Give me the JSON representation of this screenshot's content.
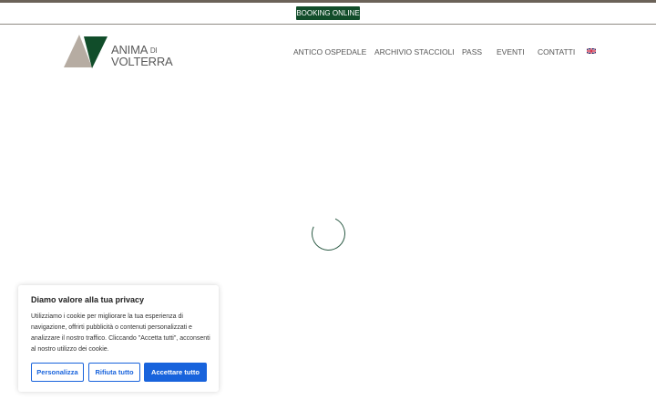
{
  "topbar": {
    "booking_label": "BOOKING ONLINE"
  },
  "logo": {
    "line1": "ANIMA",
    "line1_suffix": "DI",
    "line2": "VOLTERRA"
  },
  "nav": {
    "items": [
      {
        "label": "ANTICO OSPEDALE"
      },
      {
        "label": "ARCHIVIO STACCIOLI"
      },
      {
        "label": "PASS"
      },
      {
        "label": "EVENTI"
      },
      {
        "label": "CONTATTI"
      }
    ],
    "language_icon": "uk-flag-icon"
  },
  "loader": {
    "icon": "loading-spinner-icon"
  },
  "cookie_banner": {
    "title": "Diamo valore alla tua privacy",
    "text": "Utilizziamo i cookie per migliorare la tua esperienza di navigazione, offrirti pubblicità o contenuti personalizzati e analizzare il nostro traffico. Cliccando \"Accetta tutti\", acconsenti al nostro utilizzo dei cookie.",
    "customize_label": "Personalizza",
    "reject_label": "Rifiuta tutto",
    "accept_label": "Accettare tutto"
  },
  "colors": {
    "brand_green": "#114d2a",
    "logo_taupe": "#b6aca2",
    "cookie_blue": "#1863dc"
  }
}
